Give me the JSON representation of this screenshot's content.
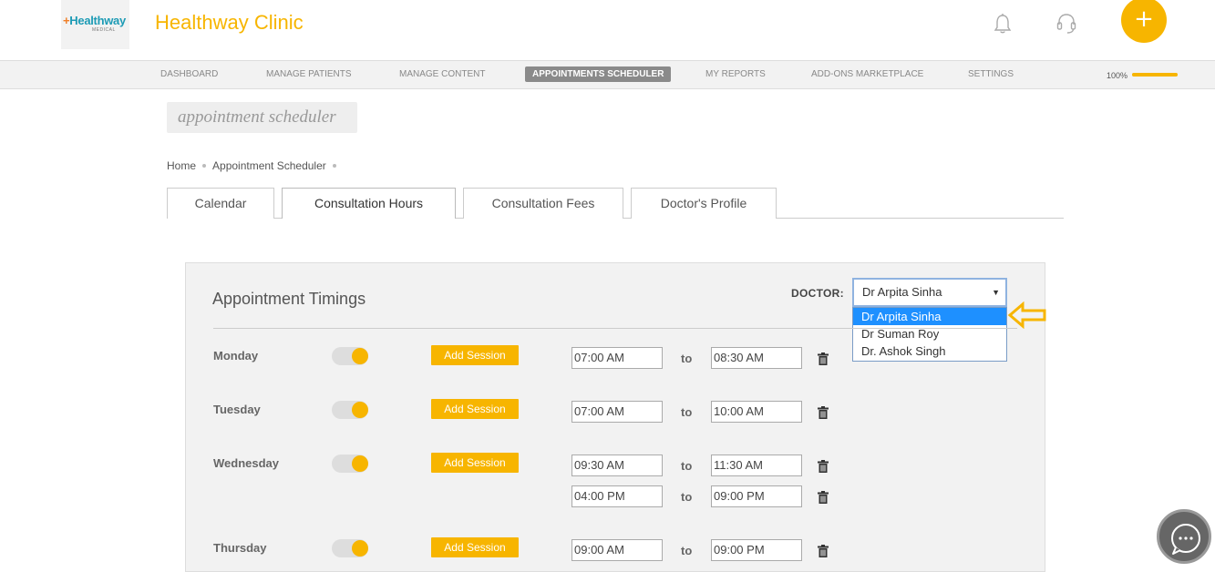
{
  "header": {
    "logo_main": "Healthway",
    "logo_plus": "+",
    "logo_sub": "MEDICAL",
    "app_title": "Healthway Clinic",
    "icons": [
      "bell-icon",
      "headset-icon",
      "plus-icon"
    ],
    "fab_label": "+"
  },
  "nav": {
    "items": [
      {
        "label": "DASHBOARD"
      },
      {
        "label": "MANAGE PATIENTS"
      },
      {
        "label": "MANAGE CONTENT"
      },
      {
        "label": "APPOINTMENTS SCHEDULER"
      },
      {
        "label": "MY REPORTS"
      },
      {
        "label": "ADD-ONS MARKETPLACE"
      },
      {
        "label": "SETTINGS"
      }
    ],
    "active_index": 3,
    "progress_label": "100%",
    "progress_value": 1.0
  },
  "page": {
    "section_label": "appointment scheduler",
    "breadcrumb": [
      "Home",
      "Appointment Scheduler"
    ]
  },
  "tabs": [
    {
      "label": "Calendar"
    },
    {
      "label": "Consultation Hours"
    },
    {
      "label": "Consultation Fees"
    },
    {
      "label": "Doctor's Profile"
    }
  ],
  "active_tab": 1,
  "panel": {
    "title": "Appointment Timings",
    "doctor_label": "DOCTOR:",
    "doctor_selected": "Dr Arpita Sinha",
    "doctor_options": [
      "Dr Arpita Sinha",
      "Dr Suman Roy",
      "Dr. Ashok Singh"
    ],
    "add_session_label": "Add Session",
    "to_label": "to",
    "days": [
      {
        "day": "Monday",
        "enabled": true,
        "sessions": [
          {
            "from": "07:00 AM",
            "to": "08:30 AM"
          }
        ]
      },
      {
        "day": "Tuesday",
        "enabled": true,
        "sessions": [
          {
            "from": "07:00 AM",
            "to": "10:00 AM"
          }
        ]
      },
      {
        "day": "Wednesday",
        "enabled": true,
        "sessions": [
          {
            "from": "09:30 AM",
            "to": "11:30 AM"
          },
          {
            "from": "04:00 PM",
            "to": "09:00 PM"
          }
        ]
      },
      {
        "day": "Thursday",
        "enabled": true,
        "sessions": [
          {
            "from": "09:00 AM",
            "to": "09:00 PM"
          }
        ]
      }
    ]
  },
  "colors": {
    "accent": "#f7b500",
    "logo_blue": "#1d9bb5",
    "logo_orange": "#f07e26",
    "nav_active": "#8a8a8a",
    "dropdown_selected": "#1e90ff"
  }
}
